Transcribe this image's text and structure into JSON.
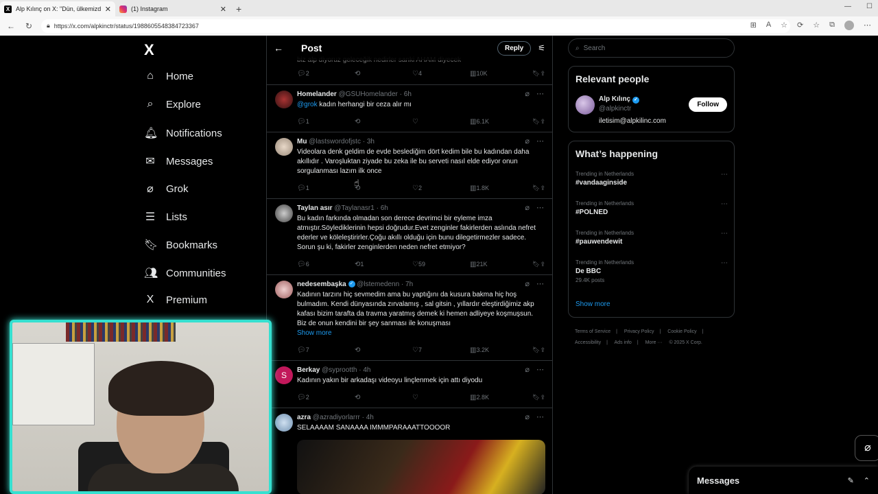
{
  "browser": {
    "tabs": [
      {
        "title": "Alp Kılınç on X: \"Dün, ülkemizdeki",
        "icon": "x-favicon",
        "active": true
      },
      {
        "title": "(1) Instagram",
        "icon": "instagram-favicon",
        "active": false
      }
    ],
    "new_tab": "+",
    "url": "https://x.com/alpkinctr/status/1988605548384723367"
  },
  "sidebar": {
    "logo": "X",
    "items": [
      {
        "label": "Home",
        "icon": "home-icon"
      },
      {
        "label": "Explore",
        "icon": "search-icon"
      },
      {
        "label": "Notifications",
        "icon": "bell-icon"
      },
      {
        "label": "Messages",
        "icon": "mail-icon"
      },
      {
        "label": "Grok",
        "icon": "grok-icon"
      },
      {
        "label": "Lists",
        "icon": "list-icon"
      },
      {
        "label": "Bookmarks",
        "icon": "bookmark-icon"
      },
      {
        "label": "Communities",
        "icon": "people-icon"
      },
      {
        "label": "Premium",
        "icon": "x-icon"
      }
    ]
  },
  "main": {
    "title": "Post",
    "reply_label": "Reply",
    "partial_text": "biz alp diyoruz geleceğik nedirler sanki AHAM diyecek",
    "tweets": [
      {
        "name": "",
        "handle": "",
        "time": "",
        "text": "",
        "replies": "2",
        "reposts": "",
        "likes": "4",
        "views": "10K"
      },
      {
        "name": "Homelander",
        "handle": "@GSUHomelander",
        "time": "· 6h",
        "mention": "@grok",
        "text": "kadın herhangi bir ceza alır mı",
        "replies": "1",
        "reposts": "",
        "likes": "",
        "views": "6.1K"
      },
      {
        "name": "Mu",
        "handle": "@lastswordofjstc",
        "time": "· 3h",
        "text": "Videolara denk geldim de evde beslediğim dört kedim bile bu kadından daha akıllıdır . Varoşluktan ziyade bu zeka ile bu serveti nasıl elde ediyor onun sorgulanması lazım ilk once",
        "replies": "1",
        "reposts": "",
        "likes": "2",
        "views": "1.8K"
      },
      {
        "name": "Taylan asır",
        "handle": "@Taylanasr1",
        "time": "· 6h",
        "text": "Bu kadın farkında olmadan son derece devrimci bir eyleme imza atmıştır.Söylediklerinin hepsi doğrudur.Evet zenginler fakirlerden aslında nefret ederler ve köleleştirirler.Çoğu akıllı olduğu için bunu dilegetirmezler sadece. Sorun şu ki, fakirler zenginlerden neden nefret etmiyor?",
        "replies": "6",
        "reposts": "1",
        "likes": "59",
        "views": "21K"
      },
      {
        "name": "nedesembaşka",
        "handle": "@lstemedenn",
        "time": "· 7h",
        "verified": true,
        "text": "Kadının tarzını hiç sevmedim ama bu yaptığını da kusura bakma hiç hoş bulmadım. Kendi dünyasında zırvalamış , sal gitsin , yıllardır eleştirdiğimiz akp kafası bizim tarafta da travma yaratmış demek ki hemen adliyeye koşmuşsun.  Biz de onun kendini bir şey sanması ile konuşması",
        "show_more": "Show more",
        "replies": "7",
        "reposts": "",
        "likes": "7",
        "views": "3.2K"
      },
      {
        "name": "Berkay",
        "handle": "@syprootth",
        "time": "· 4h",
        "avatar_letter": "S",
        "text": "Kadının yakın bir arkadaşı videoyu linçlenmek için attı diyodu",
        "replies": "2",
        "reposts": "",
        "likes": "",
        "views": "2.8K"
      },
      {
        "name": "azra",
        "handle": "@azradiyorlarrr",
        "time": "· 4h",
        "text": "SELAAAAM SANAAAA IMMMPARAAATTOOOOR"
      }
    ]
  },
  "right": {
    "search_placeholder": "Search",
    "relevant": {
      "title": "Relevant people",
      "name": "Alp Kılınç",
      "handle": "@alpkinctr",
      "bio": "iletisim@alpkilinc.com",
      "follow_label": "Follow"
    },
    "happening": {
      "title": "What’s happening",
      "trends": [
        {
          "context": "Trending in Netherlands",
          "tag": "#vandaaginside",
          "posts": ""
        },
        {
          "context": "Trending in Netherlands",
          "tag": "#POLNED",
          "posts": ""
        },
        {
          "context": "Trending in Netherlands",
          "tag": "#pauwendewit",
          "posts": ""
        },
        {
          "context": "Trending in Netherlands",
          "tag": "De BBC",
          "posts": "29.4K posts"
        }
      ],
      "show_more": "Show more"
    },
    "footer": [
      "Terms of Service",
      "|",
      "Privacy Policy",
      "|",
      "Cookie Policy",
      "|",
      "Accessibility",
      "|",
      "Ads info",
      "|",
      "More ···",
      "© 2025 X Corp."
    ]
  },
  "messages_dock": {
    "title": "Messages"
  },
  "colors": {
    "accent": "#1d9bf0",
    "border": "#2f3336",
    "webcam_border": "#35e0d0"
  }
}
